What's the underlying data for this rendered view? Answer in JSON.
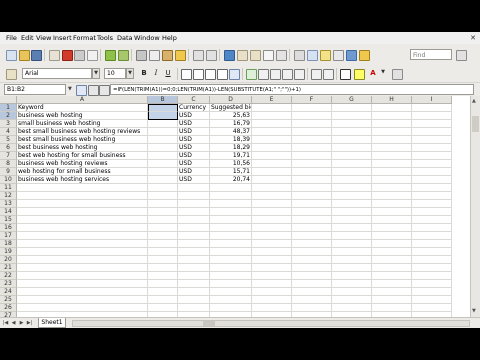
{
  "menu": [
    "File",
    "Edit",
    "View",
    "Insert",
    "Format",
    "Tools",
    "Data",
    "Window",
    "Help"
  ],
  "close_glyph": "✕",
  "find_placeholder": "Find",
  "formatting": {
    "font_name": "Arial",
    "font_size": "10",
    "bold": "B",
    "italic": "I",
    "underline": "U"
  },
  "formula_bar": {
    "name_box": "B1:B2",
    "formula": "=IF(LEN(TRIM(A1))=0;0;LEN(TRIM(A1))-LEN(SUBSTITUTE(A1;\" \";\"\"))+1)"
  },
  "columns": [
    "A",
    "B",
    "C",
    "D",
    "E",
    "F",
    "G",
    "H",
    "I"
  ],
  "rows": [
    {
      "n": "1",
      "a": "Keyword",
      "b": "",
      "c": "Currency",
      "d": "Suggested bid"
    },
    {
      "n": "2",
      "a": "business web hosting",
      "b": "",
      "c": "USD",
      "d": "25,63"
    },
    {
      "n": "3",
      "a": "small business web hosting",
      "b": "",
      "c": "USD",
      "d": "16,79"
    },
    {
      "n": "4",
      "a": "best small business web hosting reviews",
      "b": "",
      "c": "USD",
      "d": "48,37"
    },
    {
      "n": "5",
      "a": "best small business web hosting",
      "b": "",
      "c": "USD",
      "d": "18,39"
    },
    {
      "n": "6",
      "a": "best business web hosting",
      "b": "",
      "c": "USD",
      "d": "18,29"
    },
    {
      "n": "7",
      "a": "best web hosting for small business",
      "b": "",
      "c": "USD",
      "d": "19,71"
    },
    {
      "n": "8",
      "a": "business web hosting reviews",
      "b": "",
      "c": "USD",
      "d": "10,56"
    },
    {
      "n": "9",
      "a": "web hosting for small business",
      "b": "",
      "c": "USD",
      "d": "15,71"
    },
    {
      "n": "10",
      "a": "business web hosting services",
      "b": "",
      "c": "USD",
      "d": "20,74"
    },
    {
      "n": "11",
      "a": "",
      "b": "",
      "c": "",
      "d": ""
    },
    {
      "n": "12",
      "a": "",
      "b": "",
      "c": "",
      "d": ""
    },
    {
      "n": "13",
      "a": "",
      "b": "",
      "c": "",
      "d": ""
    },
    {
      "n": "14",
      "a": "",
      "b": "",
      "c": "",
      "d": ""
    },
    {
      "n": "15",
      "a": "",
      "b": "",
      "c": "",
      "d": ""
    },
    {
      "n": "16",
      "a": "",
      "b": "",
      "c": "",
      "d": ""
    },
    {
      "n": "17",
      "a": "",
      "b": "",
      "c": "",
      "d": ""
    },
    {
      "n": "18",
      "a": "",
      "b": "",
      "c": "",
      "d": ""
    },
    {
      "n": "19",
      "a": "",
      "b": "",
      "c": "",
      "d": ""
    },
    {
      "n": "20",
      "a": "",
      "b": "",
      "c": "",
      "d": ""
    },
    {
      "n": "21",
      "a": "",
      "b": "",
      "c": "",
      "d": ""
    },
    {
      "n": "22",
      "a": "",
      "b": "",
      "c": "",
      "d": ""
    },
    {
      "n": "23",
      "a": "",
      "b": "",
      "c": "",
      "d": ""
    },
    {
      "n": "24",
      "a": "",
      "b": "",
      "c": "",
      "d": ""
    },
    {
      "n": "25",
      "a": "",
      "b": "",
      "c": "",
      "d": ""
    },
    {
      "n": "26",
      "a": "",
      "b": "",
      "c": "",
      "d": ""
    },
    {
      "n": "27",
      "a": "",
      "b": "",
      "c": "",
      "d": ""
    }
  ],
  "sheet_tab": "Sheet1",
  "colors": {
    "selection": "#c5d3e8",
    "selected_header": "#b9c7dc"
  }
}
